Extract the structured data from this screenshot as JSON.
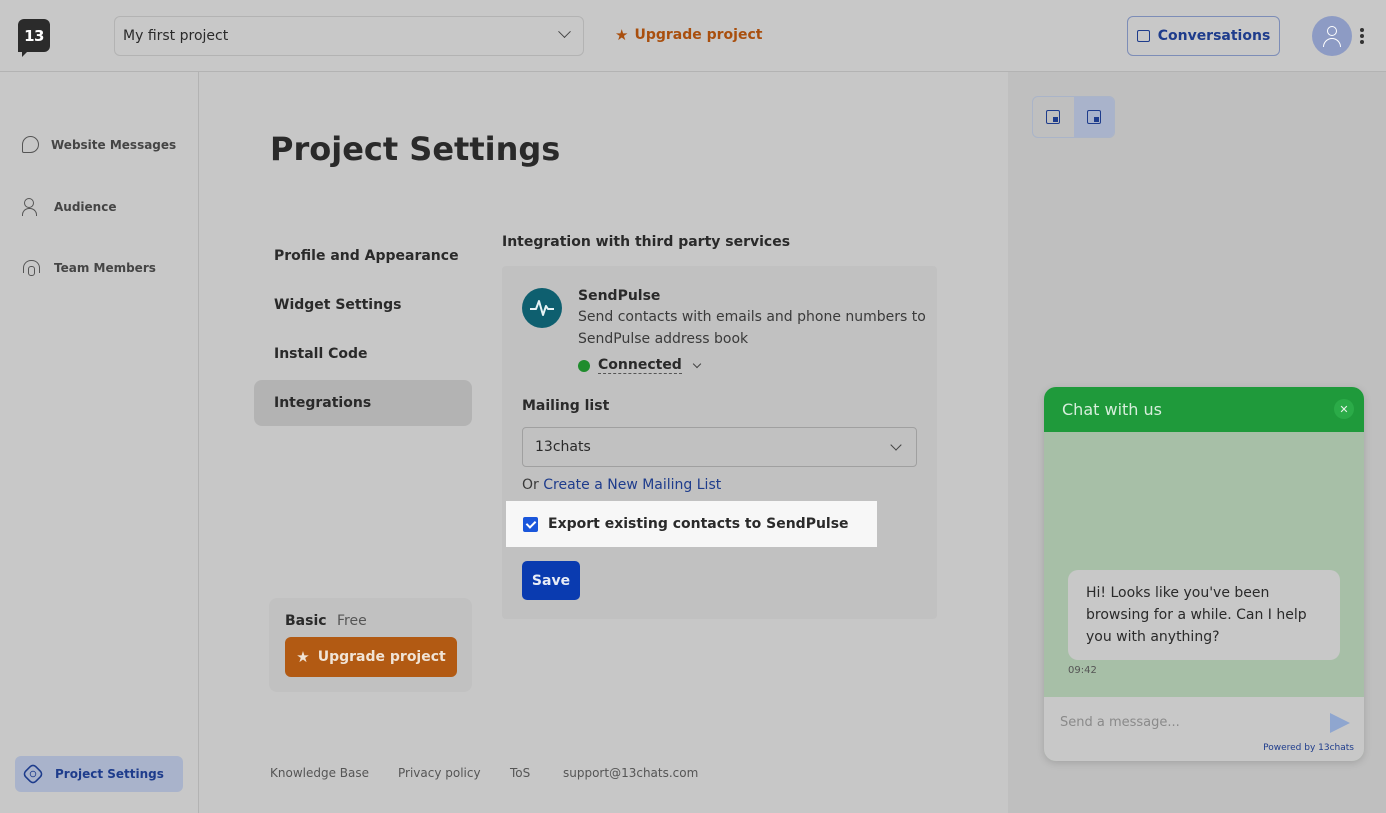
{
  "header": {
    "logo_text": "13",
    "project_name": "My first project",
    "upgrade_label": "Upgrade project",
    "conversations_label": "Conversations"
  },
  "sidebar": {
    "items": [
      {
        "label": "Website Messages",
        "icon": "message-icon"
      },
      {
        "label": "Audience",
        "icon": "users-icon"
      },
      {
        "label": "Team Members",
        "icon": "headset-icon"
      }
    ],
    "active_item": {
      "label": "Project Settings",
      "icon": "settings-icon"
    }
  },
  "main": {
    "title": "Project Settings",
    "subnav": [
      {
        "label": "Profile and Appearance"
      },
      {
        "label": "Widget Settings"
      },
      {
        "label": "Install Code"
      },
      {
        "label": "Integrations",
        "active": true
      }
    ],
    "section_title": "Integration with third party services",
    "integration": {
      "name": "SendPulse",
      "description": "Send contacts with emails and phone numbers to SendPulse address book",
      "status": "Connected",
      "status_color": "#1f8c2d",
      "mailing_list_label": "Mailing list",
      "mailing_list_value": "13chats",
      "or_text": "Or",
      "create_link": "Create a New Mailing List",
      "export_label": "Export existing contacts to SendPulse",
      "export_checked": true,
      "save_label": "Save"
    },
    "plan": {
      "name": "Basic",
      "tier": "Free",
      "upgrade_label": "Upgrade project"
    },
    "footer": [
      "Knowledge Base",
      "Privacy policy",
      "ToS",
      "support@13chats.com"
    ]
  },
  "preview": {
    "chat_title": "Chat with us",
    "message": "Hi! Looks like you've been browsing for a while. Can I help you with anything?",
    "time": "09:42",
    "input_placeholder": "Send a message...",
    "powered_by": "Powered by 13chats"
  },
  "colors": {
    "accent": "#1e3c8c",
    "brand_orange": "#b25a13",
    "chat_green": "#1f9a3b"
  }
}
